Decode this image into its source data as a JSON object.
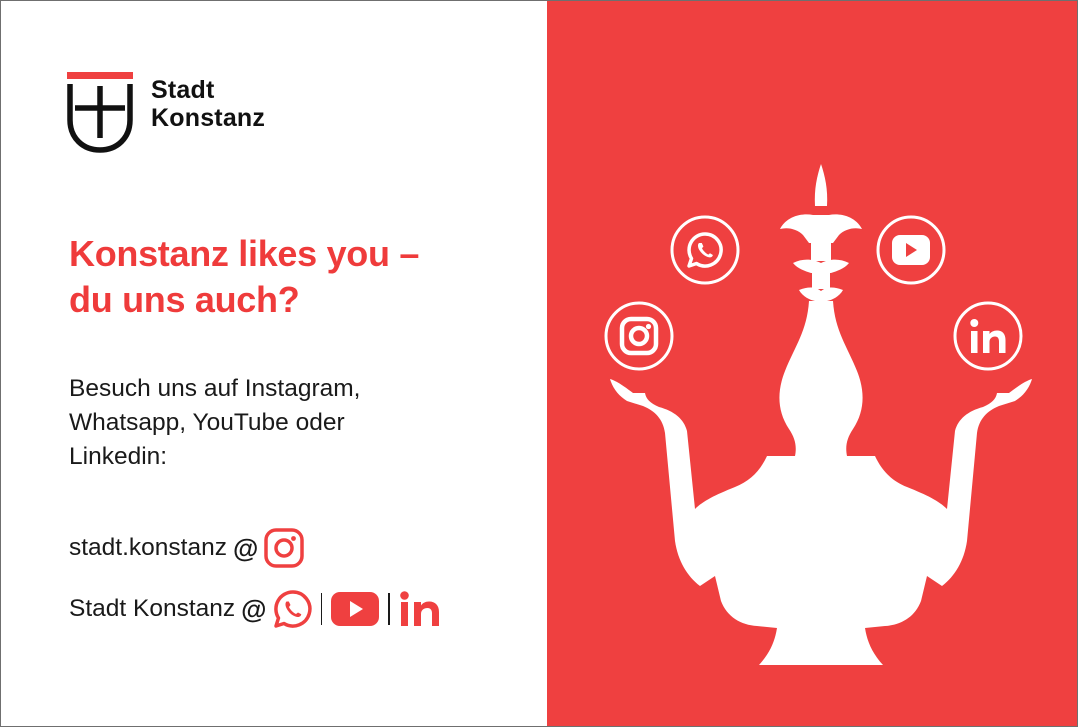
{
  "logo": {
    "line1": "Stadt",
    "line2": "Konstanz",
    "icon": "city-coat-of-arms-icon"
  },
  "headline": {
    "line1": "Konstanz likes you –",
    "line2": "du uns auch?"
  },
  "body": {
    "line1": "Besuch uns auf Instagram,",
    "line2": "Whatsapp, YouTube oder",
    "line3": "Linkedin:"
  },
  "handles": {
    "instagram_handle": "stadt.konstanz",
    "other_handle": "Stadt Konstanz",
    "at_symbol": "@"
  },
  "icons": {
    "instagram": "instagram-icon",
    "whatsapp": "whatsapp-icon",
    "youtube": "youtube-icon",
    "linkedin": "linkedin-icon",
    "linkedin_text": "in"
  },
  "colors": {
    "brand_red": "#ef4040",
    "text": "#1a1a1a",
    "background": "#ffffff"
  }
}
